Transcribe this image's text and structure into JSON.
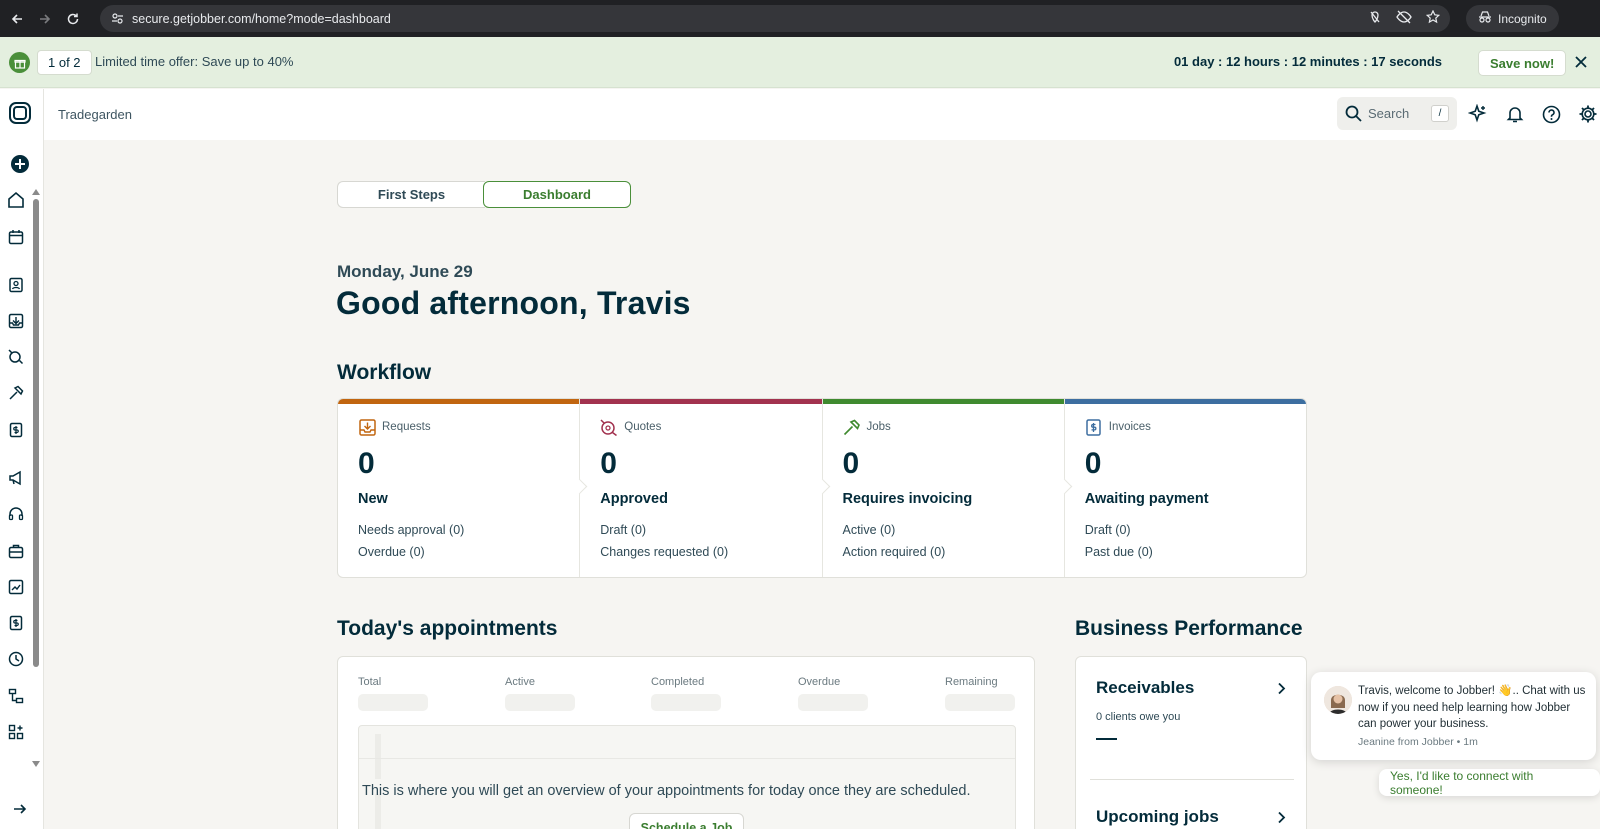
{
  "browser": {
    "url": "secure.getjobber.com/home?mode=dashboard",
    "incognito_label": "Incognito"
  },
  "promo": {
    "counter": "1 of 2",
    "offer_text": "Limited time offer: Save up to 40%",
    "countdown": "01 day : 12 hours : 12 minutes : 17 seconds",
    "save_label": "Save now!"
  },
  "header": {
    "company": "Tradegarden",
    "search_placeholder": "Search",
    "search_shortcut": "/"
  },
  "tabs": {
    "first_steps": "First Steps",
    "dashboard": "Dashboard",
    "selected": "Dashboard"
  },
  "greeting": {
    "date": "Monday, June 29",
    "message": "Good afternoon, Travis"
  },
  "workflow": {
    "title": "Workflow",
    "cards": [
      {
        "label": "Requests",
        "count": "0",
        "status": "New",
        "line1": "Needs approval (0)",
        "line2": "Overdue (0)",
        "color": "#c1650f",
        "icon": "inbox-icon"
      },
      {
        "label": "Quotes",
        "count": "0",
        "status": "Approved",
        "line1": "Draft (0)",
        "line2": "Changes requested (0)",
        "color": "#a2324f",
        "icon": "quote-icon"
      },
      {
        "label": "Jobs",
        "count": "0",
        "status": "Requires invoicing",
        "line1": "Active (0)",
        "line2": "Action required (0)",
        "color": "#3f8a2f",
        "icon": "hammer-icon"
      },
      {
        "label": "Invoices",
        "count": "0",
        "status": "Awaiting payment",
        "line1": "Draft (0)",
        "line2": "Past due (0)",
        "color": "#3d6ea0",
        "icon": "invoice-icon"
      }
    ]
  },
  "appointments": {
    "title": "Today's appointments",
    "stats": [
      "Total",
      "Active",
      "Completed",
      "Overdue",
      "Remaining"
    ],
    "empty_message": "This is where you will get an overview of your appointments for today once they are scheduled.",
    "schedule_label": "Schedule a Job"
  },
  "performance": {
    "title": "Business Performance",
    "receivables_title": "Receivables",
    "receivables_sub": "0 clients owe you",
    "upcoming_title": "Upcoming jobs"
  },
  "chat": {
    "message": "Travis, welcome to Jobber! 👋.. Chat with us now if you need help learning how Jobber can power your business.",
    "from": "Jeanine from Jobber • 1m",
    "reply": "Yes, I'd like to connect with someone!"
  },
  "colors": {
    "accent": "#3a7d2f",
    "ink": "#032b3a",
    "promo_bg": "#e4efdf"
  }
}
